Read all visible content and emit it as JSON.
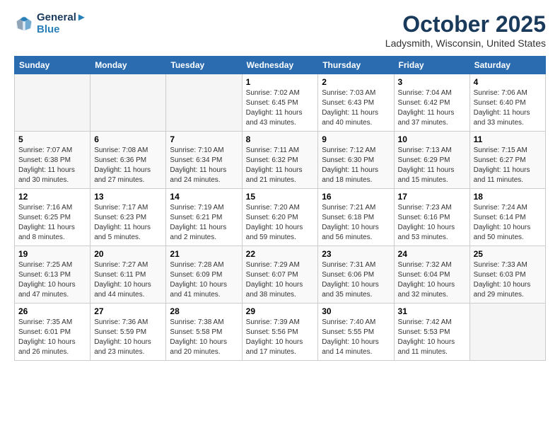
{
  "header": {
    "logo_line1": "General",
    "logo_line2": "Blue",
    "month_year": "October 2025",
    "location": "Ladysmith, Wisconsin, United States"
  },
  "weekdays": [
    "Sunday",
    "Monday",
    "Tuesday",
    "Wednesday",
    "Thursday",
    "Friday",
    "Saturday"
  ],
  "weeks": [
    [
      {
        "day": "",
        "info": ""
      },
      {
        "day": "",
        "info": ""
      },
      {
        "day": "",
        "info": ""
      },
      {
        "day": "1",
        "info": "Sunrise: 7:02 AM\nSunset: 6:45 PM\nDaylight: 11 hours\nand 43 minutes."
      },
      {
        "day": "2",
        "info": "Sunrise: 7:03 AM\nSunset: 6:43 PM\nDaylight: 11 hours\nand 40 minutes."
      },
      {
        "day": "3",
        "info": "Sunrise: 7:04 AM\nSunset: 6:42 PM\nDaylight: 11 hours\nand 37 minutes."
      },
      {
        "day": "4",
        "info": "Sunrise: 7:06 AM\nSunset: 6:40 PM\nDaylight: 11 hours\nand 33 minutes."
      }
    ],
    [
      {
        "day": "5",
        "info": "Sunrise: 7:07 AM\nSunset: 6:38 PM\nDaylight: 11 hours\nand 30 minutes."
      },
      {
        "day": "6",
        "info": "Sunrise: 7:08 AM\nSunset: 6:36 PM\nDaylight: 11 hours\nand 27 minutes."
      },
      {
        "day": "7",
        "info": "Sunrise: 7:10 AM\nSunset: 6:34 PM\nDaylight: 11 hours\nand 24 minutes."
      },
      {
        "day": "8",
        "info": "Sunrise: 7:11 AM\nSunset: 6:32 PM\nDaylight: 11 hours\nand 21 minutes."
      },
      {
        "day": "9",
        "info": "Sunrise: 7:12 AM\nSunset: 6:30 PM\nDaylight: 11 hours\nand 18 minutes."
      },
      {
        "day": "10",
        "info": "Sunrise: 7:13 AM\nSunset: 6:29 PM\nDaylight: 11 hours\nand 15 minutes."
      },
      {
        "day": "11",
        "info": "Sunrise: 7:15 AM\nSunset: 6:27 PM\nDaylight: 11 hours\nand 11 minutes."
      }
    ],
    [
      {
        "day": "12",
        "info": "Sunrise: 7:16 AM\nSunset: 6:25 PM\nDaylight: 11 hours\nand 8 minutes."
      },
      {
        "day": "13",
        "info": "Sunrise: 7:17 AM\nSunset: 6:23 PM\nDaylight: 11 hours\nand 5 minutes."
      },
      {
        "day": "14",
        "info": "Sunrise: 7:19 AM\nSunset: 6:21 PM\nDaylight: 11 hours\nand 2 minutes."
      },
      {
        "day": "15",
        "info": "Sunrise: 7:20 AM\nSunset: 6:20 PM\nDaylight: 10 hours\nand 59 minutes."
      },
      {
        "day": "16",
        "info": "Sunrise: 7:21 AM\nSunset: 6:18 PM\nDaylight: 10 hours\nand 56 minutes."
      },
      {
        "day": "17",
        "info": "Sunrise: 7:23 AM\nSunset: 6:16 PM\nDaylight: 10 hours\nand 53 minutes."
      },
      {
        "day": "18",
        "info": "Sunrise: 7:24 AM\nSunset: 6:14 PM\nDaylight: 10 hours\nand 50 minutes."
      }
    ],
    [
      {
        "day": "19",
        "info": "Sunrise: 7:25 AM\nSunset: 6:13 PM\nDaylight: 10 hours\nand 47 minutes."
      },
      {
        "day": "20",
        "info": "Sunrise: 7:27 AM\nSunset: 6:11 PM\nDaylight: 10 hours\nand 44 minutes."
      },
      {
        "day": "21",
        "info": "Sunrise: 7:28 AM\nSunset: 6:09 PM\nDaylight: 10 hours\nand 41 minutes."
      },
      {
        "day": "22",
        "info": "Sunrise: 7:29 AM\nSunset: 6:07 PM\nDaylight: 10 hours\nand 38 minutes."
      },
      {
        "day": "23",
        "info": "Sunrise: 7:31 AM\nSunset: 6:06 PM\nDaylight: 10 hours\nand 35 minutes."
      },
      {
        "day": "24",
        "info": "Sunrise: 7:32 AM\nSunset: 6:04 PM\nDaylight: 10 hours\nand 32 minutes."
      },
      {
        "day": "25",
        "info": "Sunrise: 7:33 AM\nSunset: 6:03 PM\nDaylight: 10 hours\nand 29 minutes."
      }
    ],
    [
      {
        "day": "26",
        "info": "Sunrise: 7:35 AM\nSunset: 6:01 PM\nDaylight: 10 hours\nand 26 minutes."
      },
      {
        "day": "27",
        "info": "Sunrise: 7:36 AM\nSunset: 5:59 PM\nDaylight: 10 hours\nand 23 minutes."
      },
      {
        "day": "28",
        "info": "Sunrise: 7:38 AM\nSunset: 5:58 PM\nDaylight: 10 hours\nand 20 minutes."
      },
      {
        "day": "29",
        "info": "Sunrise: 7:39 AM\nSunset: 5:56 PM\nDaylight: 10 hours\nand 17 minutes."
      },
      {
        "day": "30",
        "info": "Sunrise: 7:40 AM\nSunset: 5:55 PM\nDaylight: 10 hours\nand 14 minutes."
      },
      {
        "day": "31",
        "info": "Sunrise: 7:42 AM\nSunset: 5:53 PM\nDaylight: 10 hours\nand 11 minutes."
      },
      {
        "day": "",
        "info": ""
      }
    ]
  ]
}
